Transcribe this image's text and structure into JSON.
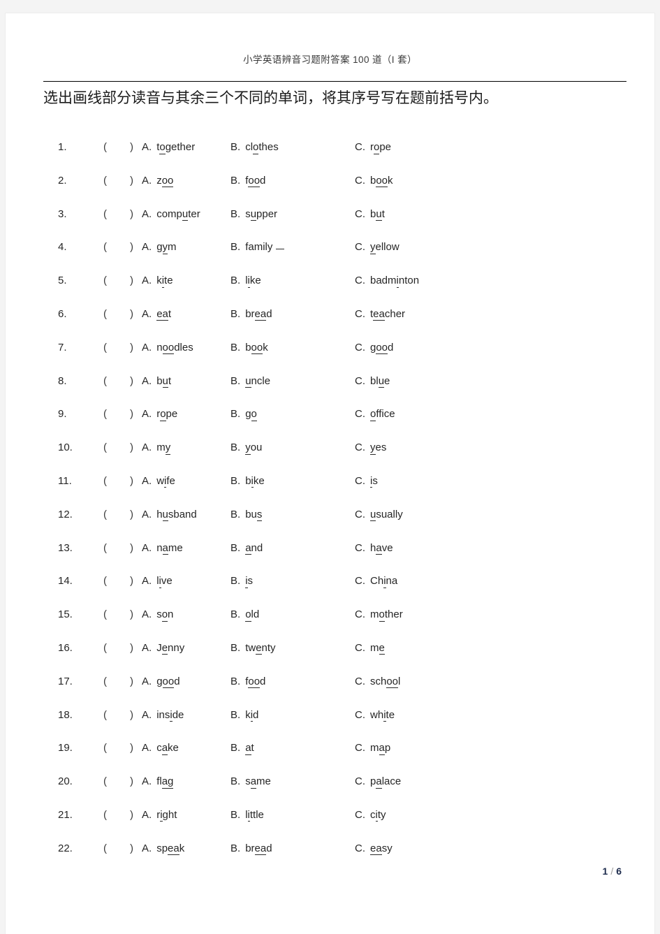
{
  "document": {
    "running_header": "小学英语辨音习题附答案 100 道（I 套）",
    "instruction": "选出画线部分读音与其余三个不同的单词，将其序号写在题前括号内。",
    "footer": {
      "current_page": "1",
      "separator": "/",
      "total_pages": "6"
    }
  },
  "option_letters": {
    "a": "A.",
    "b": "B.",
    "c": "C."
  },
  "bracket": {
    "open": "(",
    "close": ")"
  },
  "questions": [
    {
      "number": "1.",
      "options": [
        {
          "letter": "A.",
          "word": "together",
          "pre": "t",
          "underlined": "o",
          "post": "gether"
        },
        {
          "letter": "B.",
          "word": "clothes",
          "pre": "cl",
          "underlined": "o",
          "post": "thes"
        },
        {
          "letter": "C.",
          "word": "rope",
          "pre": "r",
          "underlined": "o",
          "post": "pe"
        }
      ]
    },
    {
      "number": "2.",
      "options": [
        {
          "letter": "A.",
          "word": "zoo",
          "pre": "z",
          "underlined": "oo",
          "post": ""
        },
        {
          "letter": "B.",
          "word": "food",
          "pre": "f",
          "underlined": "oo",
          "post": "d"
        },
        {
          "letter": "C.",
          "word": "book",
          "pre": "b",
          "underlined": "oo",
          "post": "k"
        }
      ]
    },
    {
      "number": "3.",
      "options": [
        {
          "letter": "A.",
          "word": "computer",
          "pre": "comp",
          "underlined": "u",
          "post": "ter"
        },
        {
          "letter": "B.",
          "word": "supper",
          "pre": "s",
          "underlined": "u",
          "post": "pper"
        },
        {
          "letter": "C.",
          "word": "but",
          "pre": "b",
          "underlined": "u",
          "post": "t"
        }
      ]
    },
    {
      "number": "4.",
      "options": [
        {
          "letter": "A.",
          "word": "gym",
          "pre": "g",
          "underlined": "y",
          "post": "m"
        },
        {
          "letter": "B.",
          "word": "family",
          "pre": "family",
          "underlined": "",
          "post": "",
          "trailing_blank": true
        },
        {
          "letter": "C.",
          "word": "yellow",
          "pre": "",
          "underlined": "y",
          "post": "ellow"
        }
      ]
    },
    {
      "number": "5.",
      "options": [
        {
          "letter": "A.",
          "word": "kite",
          "pre": "k",
          "underlined": "i",
          "post": "te"
        },
        {
          "letter": "B.",
          "word": "like",
          "pre": "l",
          "underlined": "i",
          "post": "ke"
        },
        {
          "letter": "C.",
          "word": "badminton",
          "pre": "badm",
          "underlined": "i",
          "post": "nton"
        }
      ]
    },
    {
      "number": "6.",
      "options": [
        {
          "letter": "A.",
          "word": "eat",
          "pre": "",
          "underlined": "ea",
          "post": "t"
        },
        {
          "letter": "B.",
          "word": "bread",
          "pre": "br",
          "underlined": "ea",
          "post": "d"
        },
        {
          "letter": "C.",
          "word": "teacher",
          "pre": "t",
          "underlined": "ea",
          "post": "cher"
        }
      ]
    },
    {
      "number": "7.",
      "options": [
        {
          "letter": "A.",
          "word": "noodles",
          "pre": "n",
          "underlined": "oo",
          "post": "dles"
        },
        {
          "letter": "B.",
          "word": "book",
          "pre": "b",
          "underlined": "oo",
          "post": "k"
        },
        {
          "letter": "C.",
          "word": "good",
          "pre": "g",
          "underlined": "oo",
          "post": "d"
        }
      ]
    },
    {
      "number": "8.",
      "options": [
        {
          "letter": "A.",
          "word": "but",
          "pre": "b",
          "underlined": "u",
          "post": "t"
        },
        {
          "letter": "B.",
          "word": "uncle",
          "pre": "",
          "underlined": "u",
          "post": "ncle"
        },
        {
          "letter": "C.",
          "word": "blue",
          "pre": "bl",
          "underlined": "u",
          "post": "e"
        }
      ]
    },
    {
      "number": "9.",
      "options": [
        {
          "letter": "A.",
          "word": "rope",
          "pre": "r",
          "underlined": "o",
          "post": "pe"
        },
        {
          "letter": "B.",
          "word": "go",
          "pre": "g",
          "underlined": "o",
          "post": ""
        },
        {
          "letter": "C.",
          "word": "office",
          "pre": "",
          "underlined": "o",
          "post": "ffice"
        }
      ]
    },
    {
      "number": "10.",
      "options": [
        {
          "letter": "A.",
          "word": "my",
          "pre": "m",
          "underlined": "y",
          "post": ""
        },
        {
          "letter": "B.",
          "word": "you",
          "pre": "",
          "underlined": "y",
          "post": "ou"
        },
        {
          "letter": "C.",
          "word": "yes",
          "pre": "",
          "underlined": "y",
          "post": "es"
        }
      ]
    },
    {
      "number": "11.",
      "options": [
        {
          "letter": "A.",
          "word": "wife",
          "pre": "w",
          "underlined": "i",
          "post": "fe"
        },
        {
          "letter": "B.",
          "word": "bike",
          "pre": "b",
          "underlined": "i",
          "post": "ke"
        },
        {
          "letter": "C.",
          "word": "is",
          "pre": "",
          "underlined": "i",
          "post": "s"
        }
      ]
    },
    {
      "number": "12.",
      "options": [
        {
          "letter": "A.",
          "word": "husband",
          "pre": "h",
          "underlined": "u",
          "post": "sband"
        },
        {
          "letter": "B.",
          "word": "bus",
          "pre": "bu",
          "underlined": "s",
          "post": ""
        },
        {
          "letter": "C.",
          "word": "usually",
          "pre": "",
          "underlined": "u",
          "post": "sually"
        }
      ]
    },
    {
      "number": "13.",
      "options": [
        {
          "letter": "A.",
          "word": "name",
          "pre": "n",
          "underlined": "a",
          "post": "me"
        },
        {
          "letter": "B.",
          "word": "and",
          "pre": "",
          "underlined": "a",
          "post": "nd"
        },
        {
          "letter": "C.",
          "word": "have",
          "pre": "h",
          "underlined": "a",
          "post": "ve"
        }
      ]
    },
    {
      "number": "14.",
      "options": [
        {
          "letter": "A.",
          "word": "live",
          "pre": "l",
          "underlined": "i",
          "post": "ve"
        },
        {
          "letter": "B.",
          "word": "is",
          "pre": "",
          "underlined": "i",
          "post": "s"
        },
        {
          "letter": "C.",
          "word": "China",
          "pre": "Ch",
          "underlined": "i",
          "post": "na"
        }
      ]
    },
    {
      "number": "15.",
      "options": [
        {
          "letter": "A.",
          "word": "son",
          "pre": "s",
          "underlined": "o",
          "post": "n"
        },
        {
          "letter": "B.",
          "word": "old",
          "pre": "",
          "underlined": "o",
          "post": "ld"
        },
        {
          "letter": "C.",
          "word": "mother",
          "pre": "m",
          "underlined": "o",
          "post": "ther"
        }
      ]
    },
    {
      "number": "16.",
      "options": [
        {
          "letter": "A.",
          "word": "Jenny",
          "pre": "J",
          "underlined": "e",
          "post": "nny"
        },
        {
          "letter": "B.",
          "word": "twenty",
          "pre": "tw",
          "underlined": "e",
          "post": "nty"
        },
        {
          "letter": "C.",
          "word": "me",
          "pre": "m",
          "underlined": "e",
          "post": ""
        }
      ]
    },
    {
      "number": "17.",
      "options": [
        {
          "letter": "A.",
          "word": "good",
          "pre": "g",
          "underlined": "oo",
          "post": "d"
        },
        {
          "letter": "B.",
          "word": "food",
          "pre": "f",
          "underlined": "oo",
          "post": "d"
        },
        {
          "letter": "C.",
          "word": "school",
          "pre": "sch",
          "underlined": "oo",
          "post": "l"
        }
      ]
    },
    {
      "number": "18.",
      "options": [
        {
          "letter": "A.",
          "word": "inside",
          "pre": "ins",
          "underlined": "i",
          "post": "de"
        },
        {
          "letter": "B.",
          "word": "kid",
          "pre": "k",
          "underlined": "i",
          "post": "d"
        },
        {
          "letter": "C.",
          "word": "white",
          "pre": "wh",
          "underlined": "i",
          "post": "te"
        }
      ]
    },
    {
      "number": "19.",
      "options": [
        {
          "letter": "A.",
          "word": "cake",
          "pre": "c",
          "underlined": "a",
          "post": "ke"
        },
        {
          "letter": "B.",
          "word": "at",
          "pre": "",
          "underlined": "a",
          "post": "t"
        },
        {
          "letter": "C.",
          "word": "map",
          "pre": "m",
          "underlined": "a",
          "post": "p"
        }
      ]
    },
    {
      "number": "20.",
      "options": [
        {
          "letter": "A.",
          "word": "flag",
          "pre": "fl",
          "underlined": "ag",
          "post": ""
        },
        {
          "letter": "B.",
          "word": "same",
          "pre": "s",
          "underlined": "a",
          "post": "me"
        },
        {
          "letter": "C.",
          "word": "palace",
          "pre": "p",
          "underlined": "a",
          "post": "lace"
        }
      ]
    },
    {
      "number": "21.",
      "options": [
        {
          "letter": "A.",
          "word": "right",
          "pre": "r",
          "underlined": "i",
          "post": "ght"
        },
        {
          "letter": "B.",
          "word": "little",
          "pre": "l",
          "underlined": "i",
          "post": "ttle"
        },
        {
          "letter": "C.",
          "word": "city",
          "pre": "c",
          "underlined": "i",
          "post": "ty"
        }
      ]
    },
    {
      "number": "22.",
      "options": [
        {
          "letter": "A.",
          "word": "speak",
          "pre": "sp",
          "underlined": "ea",
          "post": "k"
        },
        {
          "letter": "B.",
          "word": "bread",
          "pre": "br",
          "underlined": "ea",
          "post": "d"
        },
        {
          "letter": "C.",
          "word": "easy",
          "pre": "",
          "underlined": "ea",
          "post": "sy"
        }
      ]
    }
  ]
}
